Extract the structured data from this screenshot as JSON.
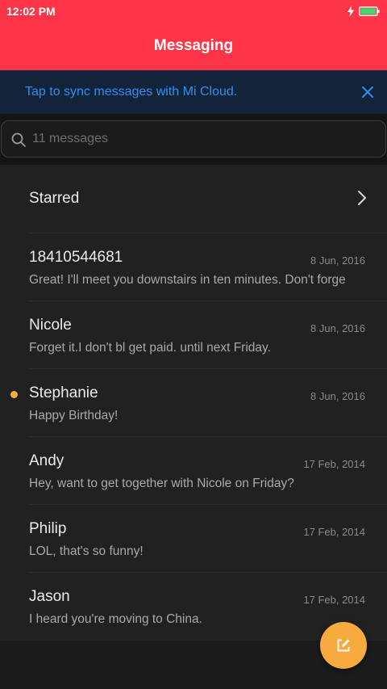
{
  "status_bar": {
    "time": "12:02 PM",
    "icons": [
      "charging-icon",
      "battery-icon"
    ]
  },
  "header": {
    "title": "Messaging"
  },
  "sync_banner": {
    "text": "Tap to sync messages with Mi Cloud.",
    "close_icon": "close-icon"
  },
  "search": {
    "placeholder": "11 messages",
    "value": "",
    "icon": "search-icon"
  },
  "starred": {
    "label": "Starred",
    "icon": "chevron-right-icon"
  },
  "messages": [
    {
      "name": "18410544681",
      "date": "8 Jun, 2016",
      "preview": "Great! I'll meet you downstairs in ten minutes. Don't forge",
      "unread": false
    },
    {
      "name": "Nicole",
      "date": "8 Jun, 2016",
      "preview": "Forget it.I don't bl get paid. until next Friday.",
      "unread": false
    },
    {
      "name": "Stephanie",
      "date": "8 Jun, 2016",
      "preview": "Happy Birthday!",
      "unread": true
    },
    {
      "name": "Andy",
      "date": "17 Feb, 2014",
      "preview": "Hey, want to get together with Nicole on Friday?",
      "unread": false
    },
    {
      "name": "Philip",
      "date": "17 Feb, 2014",
      "preview": "LOL, that's so funny!",
      "unread": false
    },
    {
      "name": "Jason",
      "date": "17 Feb, 2014",
      "preview": "I heard you're moving to China.",
      "unread": false
    }
  ],
  "fab": {
    "icon": "compose-icon"
  },
  "colors": {
    "header": "#fe3548",
    "sync_text": "#2e8ff0",
    "unread_dot": "#f6ae3c",
    "fab": "#f7ab3e",
    "background": "#1b1b1b"
  }
}
